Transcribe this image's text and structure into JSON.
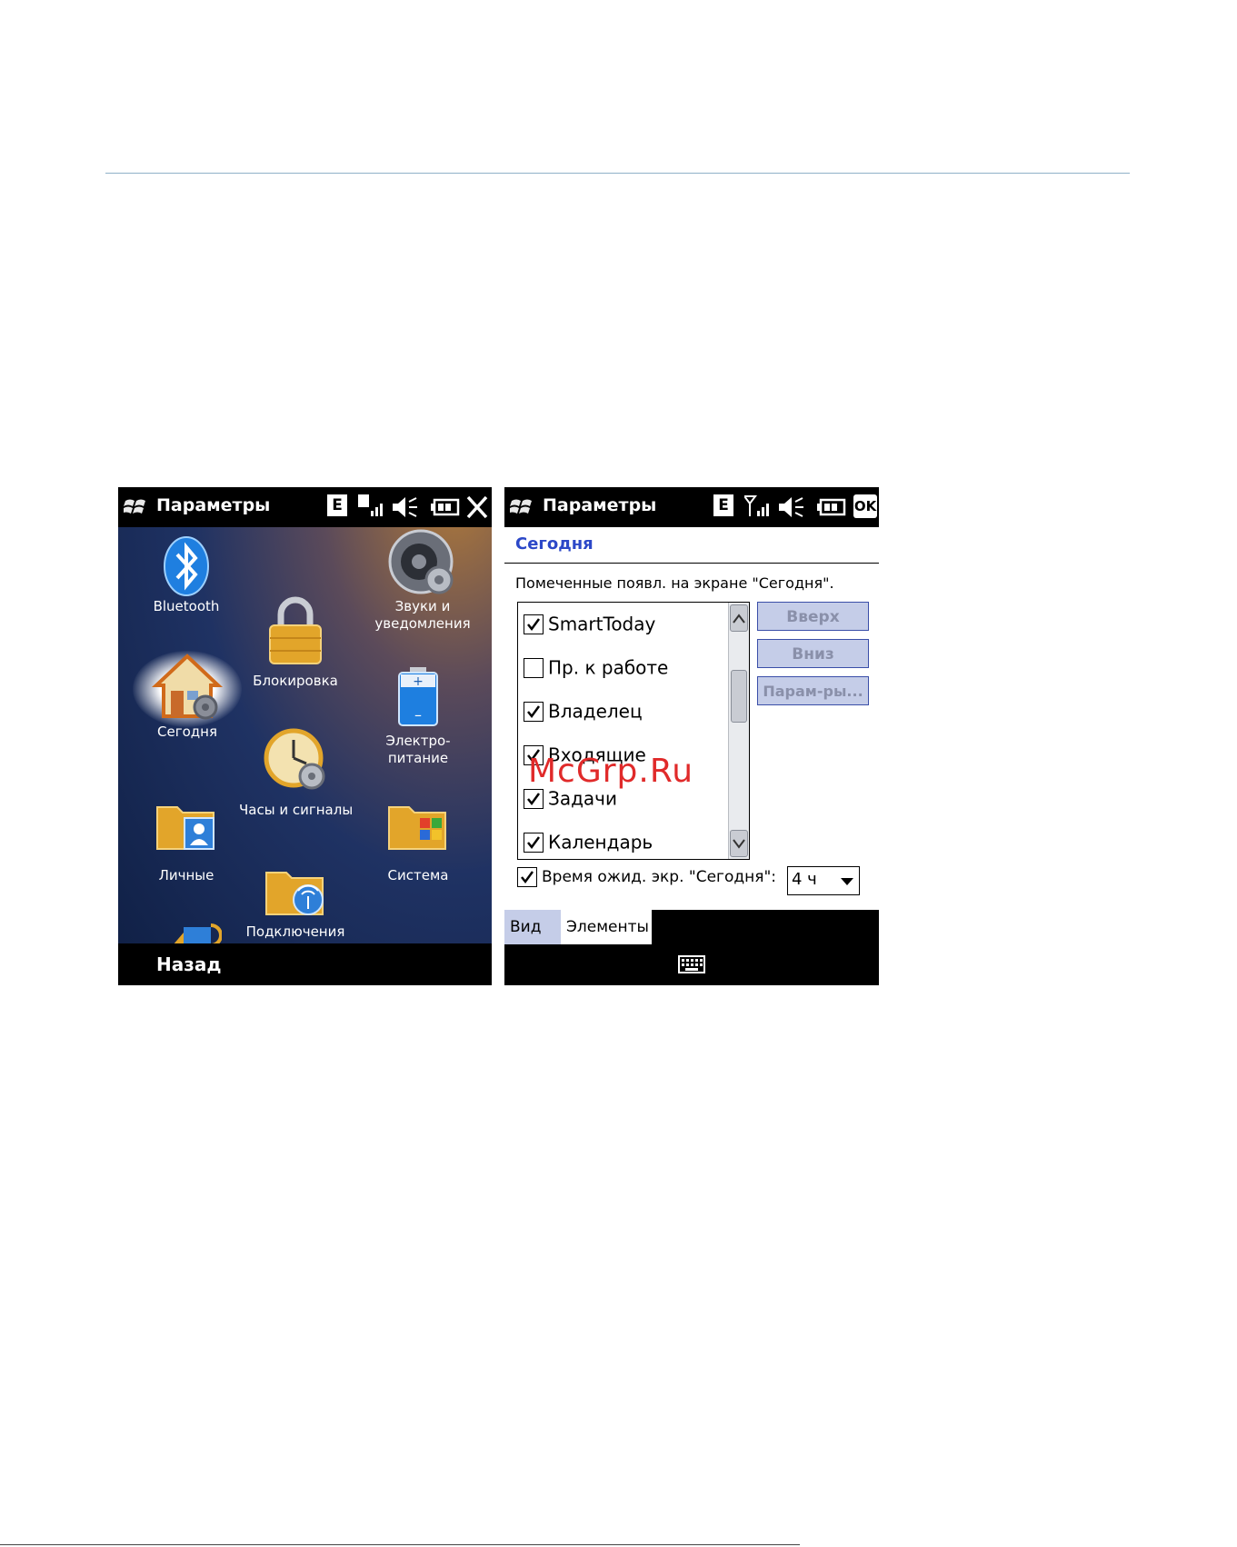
{
  "watermark": "McGrp.Ru",
  "left_screen": {
    "status_title": "Параметры",
    "network_badge": "E",
    "soft_key_left": "Назад",
    "tiles": [
      {
        "id": "bluetooth",
        "label": "Bluetooth",
        "icon": "bluetooth-icon"
      },
      {
        "id": "sounds",
        "label": "Звуки и\nуведомления",
        "label1": "Звуки и",
        "label2": "уведомления",
        "icon": "speaker-gear-icon"
      },
      {
        "id": "lock",
        "label": "Блокировка",
        "icon": "padlock-icon"
      },
      {
        "id": "today",
        "label": "Сегодня",
        "icon": "house-gear-icon"
      },
      {
        "id": "power",
        "label1": "Электро-",
        "label2": "питание",
        "icon": "battery-icon"
      },
      {
        "id": "clock",
        "label": "Часы и сигналы",
        "icon": "clock-gear-icon"
      },
      {
        "id": "personal",
        "label": "Личные",
        "icon": "folder-person-icon"
      },
      {
        "id": "system",
        "label": "Система",
        "icon": "folder-windows-icon"
      },
      {
        "id": "connections",
        "label": "Подключения",
        "icon": "folder-antenna-icon"
      }
    ]
  },
  "right_screen": {
    "status_title": "Параметры",
    "network_badge": "E",
    "ok_label": "OK",
    "heading": "Сегодня",
    "instruction": "Помеченные появл. на экране \"Сегодня\".",
    "items": [
      {
        "label": "SmartToday",
        "checked": true
      },
      {
        "label": "Пр. к работе",
        "checked": false
      },
      {
        "label": "Владелец",
        "checked": true
      },
      {
        "label": "Входящие",
        "checked": true
      },
      {
        "label": "Задачи",
        "checked": true
      },
      {
        "label": "Календарь",
        "checked": true
      }
    ],
    "buttons": {
      "up": "Вверх",
      "down": "Вниз",
      "options": "Парам-ры..."
    },
    "timeout_label": "Время ожид. экр. \"Сегодня\":",
    "timeout_checked": true,
    "timeout_value": "4 ч",
    "tabs": {
      "view": "Вид",
      "items": "Элементы"
    }
  },
  "colors": {
    "heading": "#2c48c8",
    "button_bg": "#c5cde8",
    "button_text": "#8a90aa",
    "watermark": "#e02a2a"
  }
}
